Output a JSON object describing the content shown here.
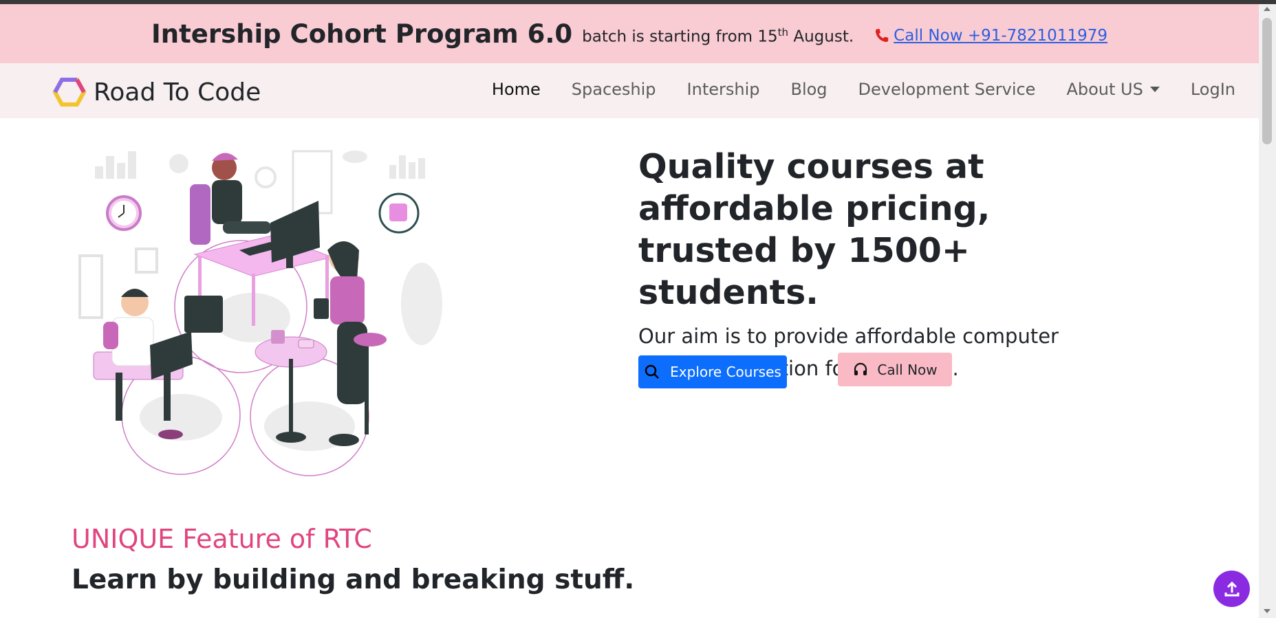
{
  "announcement": {
    "title": "Intership Cohort Program 6.0",
    "text_before": "batch is starting from 15",
    "superscript": "th",
    "text_after": " August.",
    "call_link": "Call Now +91-7821011979",
    "call_icon": "phone-icon"
  },
  "brand": {
    "name": "Road To Code",
    "logo_icon": "hexagon-logo-icon"
  },
  "nav": {
    "items": [
      {
        "label": "Home",
        "active": true
      },
      {
        "label": "Spaceship"
      },
      {
        "label": "Intership"
      },
      {
        "label": "Blog"
      },
      {
        "label": "Development Service"
      },
      {
        "label": "About US",
        "dropdown": true
      },
      {
        "label": "LogIn"
      }
    ]
  },
  "hero": {
    "title": "Quality courses at affordable pricing, trusted by 1500+ students.",
    "subtitle": "Our aim is to provide affordable computer science education for everyone.",
    "explore_button": "Explore Courses",
    "call_button": "Call Now",
    "explore_icon": "search-icon",
    "call_icon": "headset-icon"
  },
  "features": {
    "label": "UNIQUE Feature of RTC",
    "title": "Learn by building and breaking stuff."
  },
  "colors": {
    "announce_bg": "#f9cbd3",
    "nav_bg": "#f7eff0",
    "primary": "#0d6efd",
    "accent_pink": "#e0457f",
    "scroll_top": "#8a2be2"
  }
}
